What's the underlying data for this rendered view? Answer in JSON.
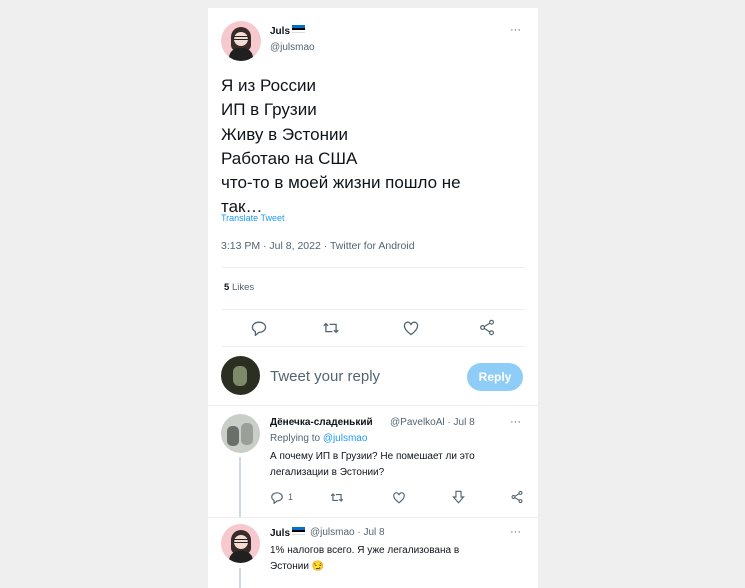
{
  "tweet": {
    "author_name": "Juls",
    "author_handle": "@julsmao",
    "more": "···",
    "lines": [
      "Я из России",
      "ИП в Грузии",
      "Живу в Эстонии",
      "Работаю на США",
      "что-то в моей жизни пошло не",
      "так…"
    ],
    "translate_label": "Translate Tweet",
    "timestamp": "3:13 PM · Jul 8, 2022 · Twitter for Android",
    "likes_count": "5",
    "likes_label": "Likes"
  },
  "action_icons": [
    "reply-icon",
    "retweet-icon",
    "like-icon",
    "share-icon"
  ],
  "composer": {
    "placeholder": "Tweet your reply",
    "button_label": "Reply"
  },
  "replies": [
    {
      "author_name": "Дёнечка-сладенький",
      "author_handle": "@PavelkoAl",
      "date": "· Jul 8",
      "more": "···",
      "replying_prefix": "Replying to",
      "replying_handle": "@julsmao",
      "text_lines": [
        "А почему ИП в Грузии? Не помешает ли это",
        "легализации в Эстонии?"
      ],
      "reply_count": "1"
    },
    {
      "author_name": "Juls",
      "author_handle": "@julsmao",
      "date": "· Jul 8",
      "more": "···",
      "text_lines": [
        "1% налогов всего. Я уже легализована в",
        "Эстонии 😏"
      ]
    }
  ],
  "colors": {
    "accent": "#1d9bf0",
    "reply_button": "#8ecdf7",
    "secondary_text": "#536471",
    "flag_estonia": [
      "#0072ce",
      "#000000",
      "#ffffff"
    ]
  }
}
